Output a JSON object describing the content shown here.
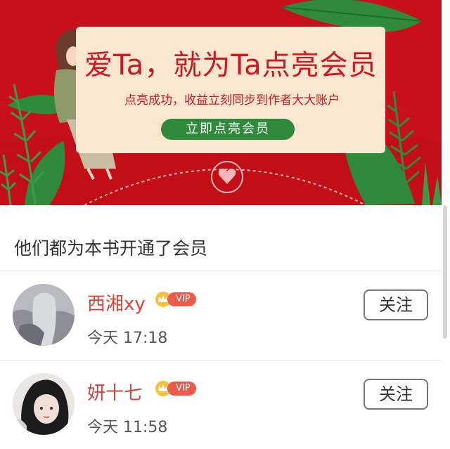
{
  "banner": {
    "title": "爱Ta，就为Ta点亮会员",
    "subtitle": "点亮成功，收益立刻同步到作者大大账户",
    "cta_label": "立即点亮会员",
    "colors": {
      "background": "#c8101a",
      "card": "#fbe6d0",
      "accent": "#d0161f",
      "button": "#2f8a3c"
    }
  },
  "section": {
    "title": "他们都为本书开通了会员"
  },
  "members": [
    {
      "name": "西湘xy",
      "vip_label": "VIP",
      "time": "今天 17:18",
      "follow_label": "关注"
    },
    {
      "name": "妍十七",
      "vip_label": "VIP",
      "time": "今天 11:58",
      "follow_label": "关注"
    }
  ]
}
